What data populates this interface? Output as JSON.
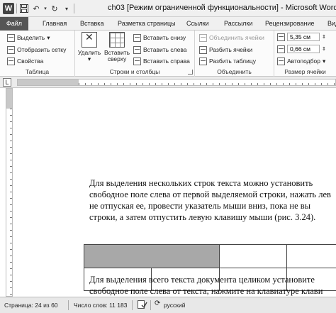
{
  "window": {
    "title": "ch03 [Режим ограниченной функциональности] - Microsoft Word",
    "app_icon": "W"
  },
  "tabs": [
    {
      "label": "Файл"
    },
    {
      "label": "Главная"
    },
    {
      "label": "Вставка"
    },
    {
      "label": "Разметка страницы"
    },
    {
      "label": "Ссылки"
    },
    {
      "label": "Рассылки"
    },
    {
      "label": "Рецензирование"
    },
    {
      "label": "Вид"
    }
  ],
  "ribbon": {
    "table_group": {
      "label": "Таблица",
      "select": "Выделить",
      "show_grid": "Отобразить сетку",
      "properties": "Свойства"
    },
    "rows_cols_group": {
      "label": "Строки и столбцы",
      "delete": "Удалить",
      "insert_above_line1": "Вставить",
      "insert_above_line2": "сверху",
      "insert_below": "Вставить снизу",
      "insert_left": "Вставить слева",
      "insert_right": "Вставить справа"
    },
    "merge_group": {
      "label": "Объединить",
      "merge_cells": "Объединить ячейки",
      "split_cells": "Разбить ячейки",
      "split_table": "Разбить таблицу"
    },
    "cell_size_group": {
      "label": "Размер ячейки",
      "height": "5,35 см",
      "width": "0,66 см",
      "autofit": "Автоподбор"
    }
  },
  "document": {
    "paragraph1": [
      "Для выделения нескольких строк текста можно установить",
      "свободное поле слева от первой выделяемой строки, нажать лев",
      "не отпуская ее, провести указатель мыши вниз, пока не вы",
      "строки, а затем отпустить левую клавишу мыши (рис. 3.24)."
    ],
    "paragraph2": [
      "Для выделения всего текста документа целиком установите",
      "свободное поле слева от текста, нажмите на клавиатуре клави"
    ]
  },
  "statusbar": {
    "page": "Страница: 24 из 60",
    "words": "Число слов: 11 183",
    "language": "русский"
  }
}
